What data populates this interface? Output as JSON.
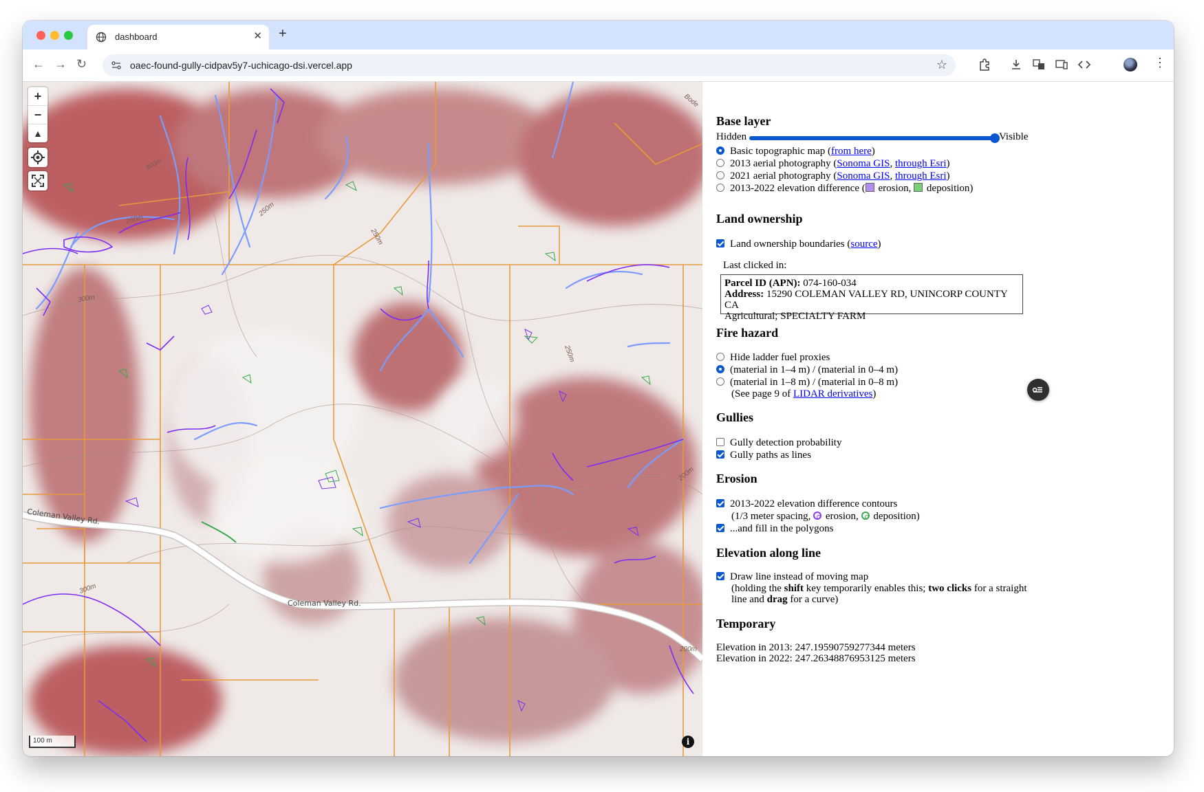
{
  "browser": {
    "tab_title": "dashboard",
    "new_tab": "+",
    "close": "✕",
    "url": "oaec-found-gully-cidpav5y7-uchicago-dsi.vercel.app",
    "nav": {
      "back": "←",
      "forward": "→",
      "reload": "↻"
    },
    "star": "☆",
    "kebab": "⋮"
  },
  "map": {
    "zoom_in": "+",
    "zoom_out": "−",
    "compass": "▲",
    "scale": "100 m",
    "info": "i",
    "road_labels": [
      "Coleman Valley Rd.",
      "Coleman Valley Rd."
    ],
    "contour_labels": [
      "300m",
      "250m",
      "250m",
      "250m",
      "200m",
      "300m",
      "300m",
      "250m",
      "200m",
      "Bode"
    ],
    "colors": {
      "fire_hazard": "#b0454a",
      "parcel_lines": "#e79a3a",
      "gully_lines": "#7a9cff",
      "erosion": "#7b2cf5",
      "deposition": "#3aa84a"
    }
  },
  "panel": {
    "base_layer": {
      "heading": "Base layer",
      "slider_min": "Hidden",
      "slider_max": "Visible",
      "slider_value": 1.0,
      "options": [
        {
          "pre": "Basic topographic map (",
          "links": [
            "from here"
          ],
          "post": ")",
          "selected": true
        },
        {
          "pre": "2013 aerial photography (",
          "links": [
            "Sonoma GIS",
            "through Esri"
          ],
          "post": ")",
          "selected": false
        },
        {
          "pre": "2021 aerial photography (",
          "links": [
            "Sonoma GIS",
            "through Esri"
          ],
          "post": ")",
          "selected": false
        }
      ],
      "elevation_option": {
        "pre": "2013-2022 elevation difference (",
        "erosion": "erosion,",
        "deposition": "deposition)",
        "selected": false
      }
    },
    "land_ownership": {
      "heading": "Land ownership",
      "checkbox_label": "Land ownership boundaries (",
      "source_link": "source",
      "checkbox_post": ")",
      "checked": true,
      "last_clicked": "Last clicked in:",
      "parcel_label": "Parcel ID (APN):",
      "parcel_value": " 074-160-034",
      "address_label": "Address:",
      "address_value": " 15290 COLEMAN VALLEY RD, UNINCORP COUNTY CA",
      "use": "Agricultural; SPECIALTY FARM"
    },
    "fire_hazard": {
      "heading": "Fire hazard",
      "options": [
        {
          "label": "Hide ladder fuel proxies",
          "selected": false
        },
        {
          "label": "(material in 1–4 m) / (material in 0–4 m)",
          "selected": true
        },
        {
          "label": "(material in 1–8 m) / (material in 0–8 m)",
          "selected": false
        }
      ],
      "note_pre": "(See page 9 of ",
      "note_link": "LIDAR derivatives",
      "note_post": ")"
    },
    "gullies": {
      "heading": "Gullies",
      "options": [
        {
          "label": "Gully detection probability",
          "checked": false
        },
        {
          "label": "Gully paths as lines",
          "checked": true
        }
      ]
    },
    "erosion": {
      "heading": "Erosion",
      "contours_label": "2013-2022 elevation difference contours",
      "contours_sub_pre": "(1/3 meter spacing,",
      "contours_sub_erosion": "erosion,",
      "contours_sub_deposition": "deposition)",
      "fill_label": "...and fill in the polygons",
      "contours_checked": true,
      "fill_checked": true
    },
    "elevation_line": {
      "heading": "Elevation along line",
      "label": "Draw line instead of moving map",
      "note_1": "(holding the ",
      "note_shift": "shift",
      "note_2": " key temporarily enables this; ",
      "note_two": "two clicks",
      "note_3": " for a straight",
      "note_4": "line and ",
      "note_drag": "drag",
      "note_5": " for a curve)",
      "checked": true
    },
    "temporary": {
      "heading": "Temporary",
      "line_2013": "Elevation in 2013: 247.19590759277344 meters",
      "line_2022": "Elevation in 2022: 247.26348876953125 meters"
    }
  }
}
